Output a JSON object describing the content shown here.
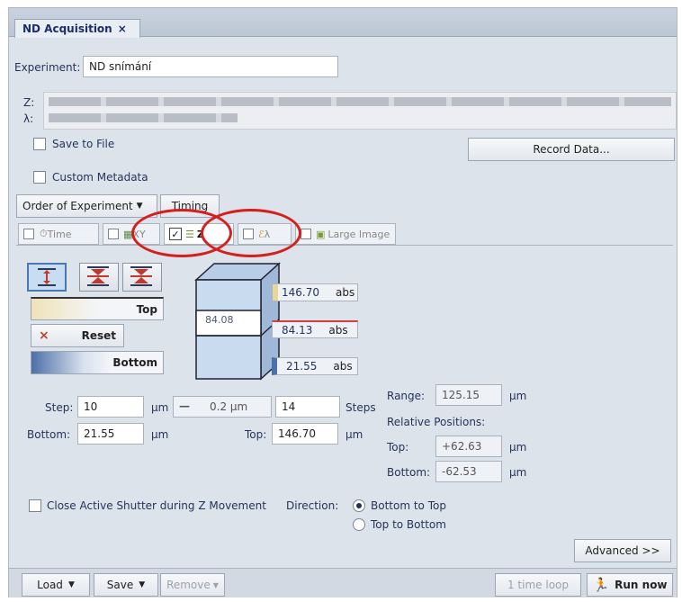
{
  "tab": {
    "title": "ND Acquisition",
    "close": "×"
  },
  "experiment": {
    "label": "Experiment:",
    "value": "ND snímání"
  },
  "strips": {
    "z_label": "Z:",
    "lambda_label": "λ:"
  },
  "save_to_file": "Save to File",
  "record_data": "Record Data...",
  "custom_metadata": "Custom Metadata",
  "order_of_experiment": "Order of Experiment",
  "timing": "Timing",
  "type_tabs": {
    "time": "Time",
    "xy": "XY",
    "z": "Z",
    "lambda": "λ",
    "large_image": "Large Image"
  },
  "zcontrols": {
    "top": "Top",
    "reset": "Reset",
    "bottom": "Bottom"
  },
  "diagram": {
    "top_value": "146.70",
    "mid_value": "84.13",
    "bottom_value": "21.55",
    "current": "84.08",
    "abs": "abs"
  },
  "step": {
    "label": "Step:",
    "value": "10",
    "unit": "μm",
    "sub_value": "0.2 μm",
    "steps_value": "14",
    "steps_label": "Steps"
  },
  "range_bottom": {
    "label": "Bottom:",
    "value": "21.55",
    "unit": "μm"
  },
  "range_top": {
    "label": "Top:",
    "value": "146.70",
    "unit": "μm"
  },
  "range": {
    "label": "Range:",
    "value": "125.15",
    "unit": "μm"
  },
  "relative": {
    "title": "Relative Positions:",
    "top_label": "Top:",
    "top_value": "+62.63",
    "bottom_label": "Bottom:",
    "bottom_value": "-62.53",
    "unit": "μm"
  },
  "close_shutter": "Close Active Shutter during Z Movement",
  "direction": {
    "label": "Direction:",
    "opt1": "Bottom to Top",
    "opt2": "Top to Bottom",
    "selected": "Bottom to Top"
  },
  "advanced": "Advanced >>",
  "footer": {
    "load": "Load",
    "save": "Save",
    "remove": "Remove",
    "loop": "1 time loop",
    "run": "Run now"
  },
  "colors": {
    "accent": "#4a78b5",
    "annotation": "#d51f1f"
  }
}
